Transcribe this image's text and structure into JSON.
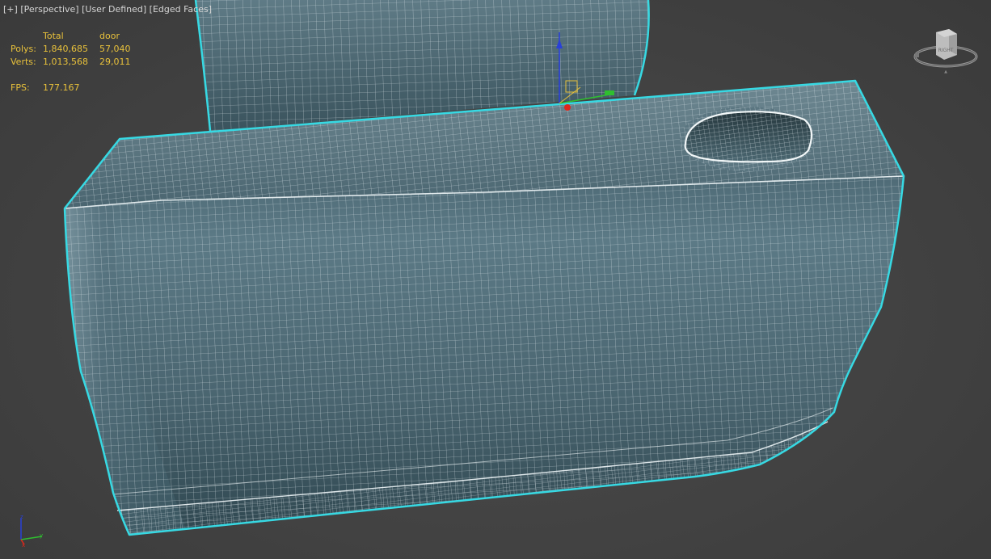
{
  "viewport": {
    "label_plus": "[+]",
    "label_view": "[Perspective]",
    "label_shading": "[User Defined]",
    "label_faces": "[Edged Faces]"
  },
  "stats": {
    "header_total": "Total",
    "header_object": "door",
    "polys_label": "Polys:",
    "polys_total": "1,840,685",
    "polys_object": "57,040",
    "verts_label": "Verts:",
    "verts_total": "1,013,568",
    "verts_object": "29,011",
    "fps_label": "FPS:",
    "fps_value": "177.167"
  },
  "viewcube": {
    "face_label": "RIGHT"
  },
  "axis_tripod": {
    "z_label": "z",
    "y_label": "y",
    "x_label": "x"
  },
  "colors": {
    "background": "#444444",
    "mesh_fill": "#44606c",
    "wire": "#dfe9ec",
    "selection_outline": "#37d9e3",
    "stats_text": "#e8c13b",
    "gizmo_x": "#e0261b",
    "gizmo_y": "#2fbf2f",
    "gizmo_z": "#2940d8"
  }
}
